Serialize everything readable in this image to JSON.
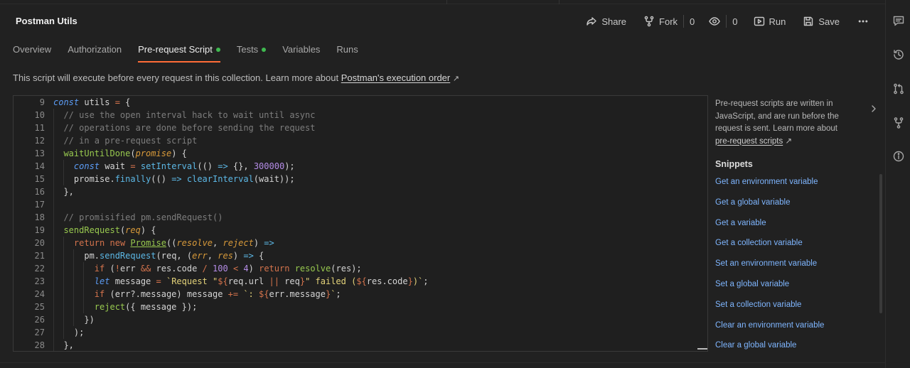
{
  "collection": {
    "title": "Postman Utils"
  },
  "actions": {
    "share": "Share",
    "fork": "Fork",
    "fork_count": "0",
    "watch_count": "0",
    "run": "Run",
    "save": "Save"
  },
  "tabs": [
    {
      "label": "Overview",
      "active": false,
      "dot": false
    },
    {
      "label": "Authorization",
      "active": false,
      "dot": false
    },
    {
      "label": "Pre-request Script",
      "active": true,
      "dot": true
    },
    {
      "label": "Tests",
      "active": false,
      "dot": true
    },
    {
      "label": "Variables",
      "active": false,
      "dot": false
    },
    {
      "label": "Runs",
      "active": false,
      "dot": false
    }
  ],
  "description": {
    "text": "This script will execute before every request in this collection. Learn more about ",
    "link": "Postman's execution order",
    "arrow": "↗"
  },
  "editor": {
    "line_numbers": [
      "9",
      "10",
      "11",
      "12",
      "13",
      "14",
      "15",
      "16",
      "17",
      "18",
      "19",
      "20",
      "21",
      "22",
      "23",
      "24",
      "25",
      "26",
      "27",
      "28"
    ]
  },
  "help": {
    "text": "Pre-request scripts are written in JavaScript, and are run before the request is sent. Learn more about ",
    "link": "pre-request scripts",
    "arrow": "↗"
  },
  "snippets": {
    "heading": "Snippets",
    "items": [
      "Get an environment variable",
      "Get a global variable",
      "Get a variable",
      "Get a collection variable",
      "Set an environment variable",
      "Set a global variable",
      "Set a collection variable",
      "Clear an environment variable",
      "Clear a global variable"
    ]
  },
  "colors": {
    "accent": "#ff6c37",
    "dot": "#3fb950",
    "link": "#7fb6ff"
  }
}
